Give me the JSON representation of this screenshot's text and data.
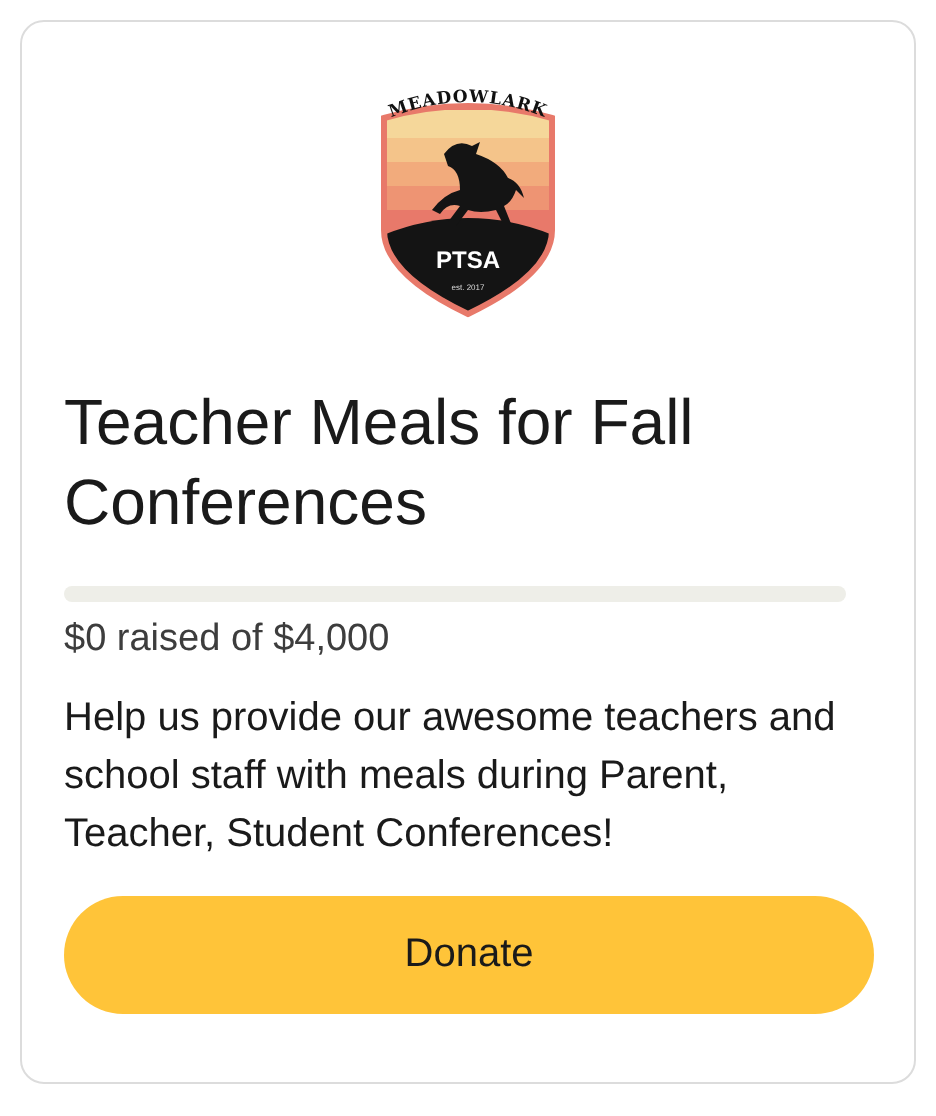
{
  "logo": {
    "arc_text": "MEADOWLARK",
    "badge_text": "PTSA",
    "small_text": "est. 2017"
  },
  "title": "Teacher Meals for Fall Conferences",
  "progress": {
    "level": 0,
    "raised": "$0 raised of $4,000"
  },
  "description": "Help us provide our awesome teachers and school staff with meals during Parent, Teacher, Student Conferences!",
  "button": {
    "label": "Donate"
  }
}
